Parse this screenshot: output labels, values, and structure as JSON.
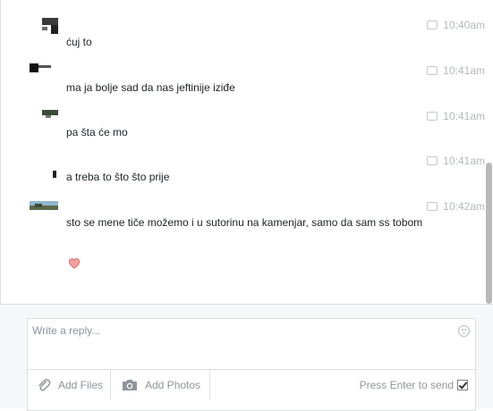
{
  "thread": {
    "messages": [
      {
        "sender": "",
        "time": "10:40am",
        "text": "ćuj to",
        "reactions": []
      },
      {
        "sender": "",
        "time": "10:41am",
        "text": "ma ja bolje sad da nas jeftinije iziđe",
        "reactions": []
      },
      {
        "sender": "",
        "time": "10:41am",
        "text": "pa šta će mo",
        "reactions": []
      },
      {
        "sender": "",
        "time": "10:41am",
        "text": "a treba to što što prije",
        "reactions": []
      },
      {
        "sender": "",
        "time": "10:42am",
        "text": "sto se mene tiče možemo i u sutorinu na kamenjar, samo da sam ss tobom",
        "reactions": [
          "heart"
        ]
      }
    ]
  },
  "composer": {
    "placeholder": "Write a reply...",
    "add_files_label": "Add Files",
    "add_photos_label": "Add Photos",
    "press_enter_label": "Press Enter to send",
    "press_enter_checked": true
  },
  "colors": {
    "sender_name": "#4b67a1",
    "timestamp": "#b3b7bf",
    "heart": "#f08080"
  }
}
